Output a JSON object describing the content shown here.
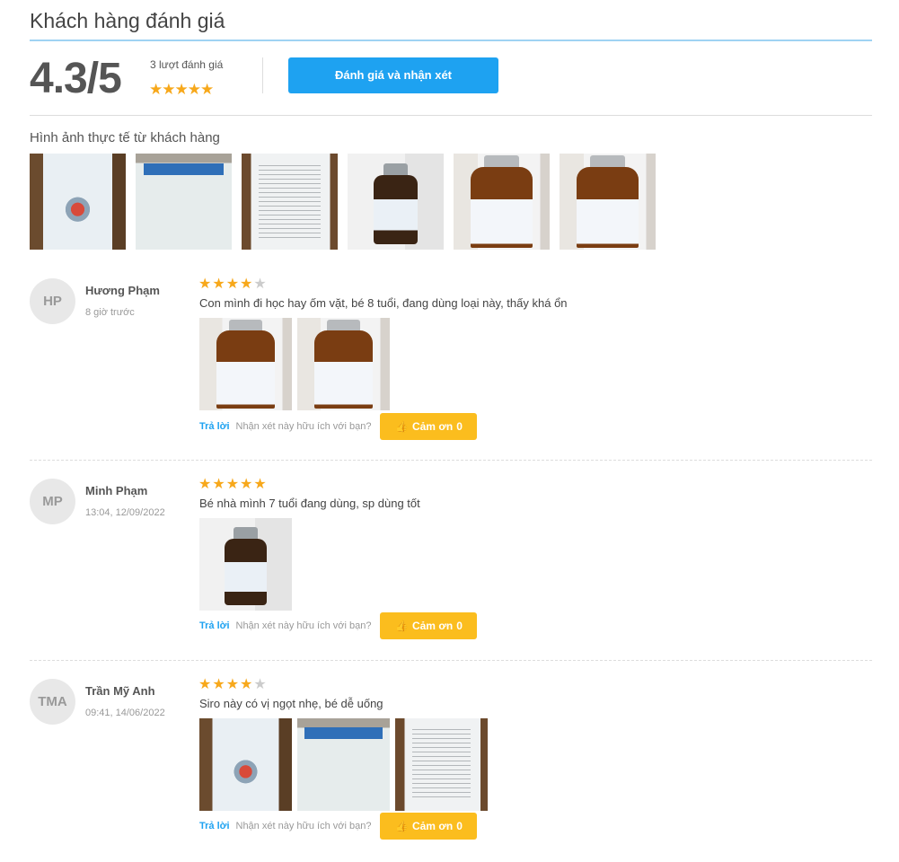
{
  "section": {
    "title": "Khách hàng đánh giá",
    "score": "4.3/5",
    "rating_count": "3 lượt đánh giá",
    "stars": "★★★★★",
    "write_review_label": "Đánh giá và nhận xét",
    "photos_label": "Hình ảnh thực tế từ khách hàng"
  },
  "reviews": [
    {
      "initials": "HP",
      "name": "Hương Phạm",
      "time": "8 giờ trước",
      "rating": 4,
      "stars_on": "★★★★",
      "stars_off": "★",
      "text": "Con mình đi học hay ốm vặt, bé 8 tuổi, đang dùng loại này, thấy khá ổn",
      "reply_label": "Trả lời",
      "helpful_label": "Nhận xét này hữu ích với bạn?",
      "thanks_label": "Cảm ơn",
      "thanks_count": "0"
    },
    {
      "initials": "MP",
      "name": "Minh Phạm",
      "time": "13:04, 12/09/2022",
      "rating": 5,
      "stars_on": "★★★★★",
      "stars_off": "",
      "text": "Bé nhà mình 7 tuổi đang dùng, sp dùng tốt",
      "reply_label": "Trả lời",
      "helpful_label": "Nhận xét này hữu ích với bạn?",
      "thanks_label": "Cảm ơn",
      "thanks_count": "0"
    },
    {
      "initials": "TMA",
      "name": "Trần Mỹ Anh",
      "time": "09:41, 14/06/2022",
      "rating": 4,
      "stars_on": "★★★★",
      "stars_off": "★",
      "text": "Siro này có vị ngọt nhẹ, bé dễ uống",
      "reply_label": "Trả lời",
      "helpful_label": "Nhận xét này hữu ích với bạn?",
      "thanks_label": "Cảm ơn",
      "thanks_count": "0"
    }
  ],
  "colors": {
    "accent": "#1ea2f1",
    "star": "#f7a81b",
    "thanks": "#fbbd1e"
  },
  "icons": [
    "thumbs-up-icon",
    "star-icon"
  ]
}
